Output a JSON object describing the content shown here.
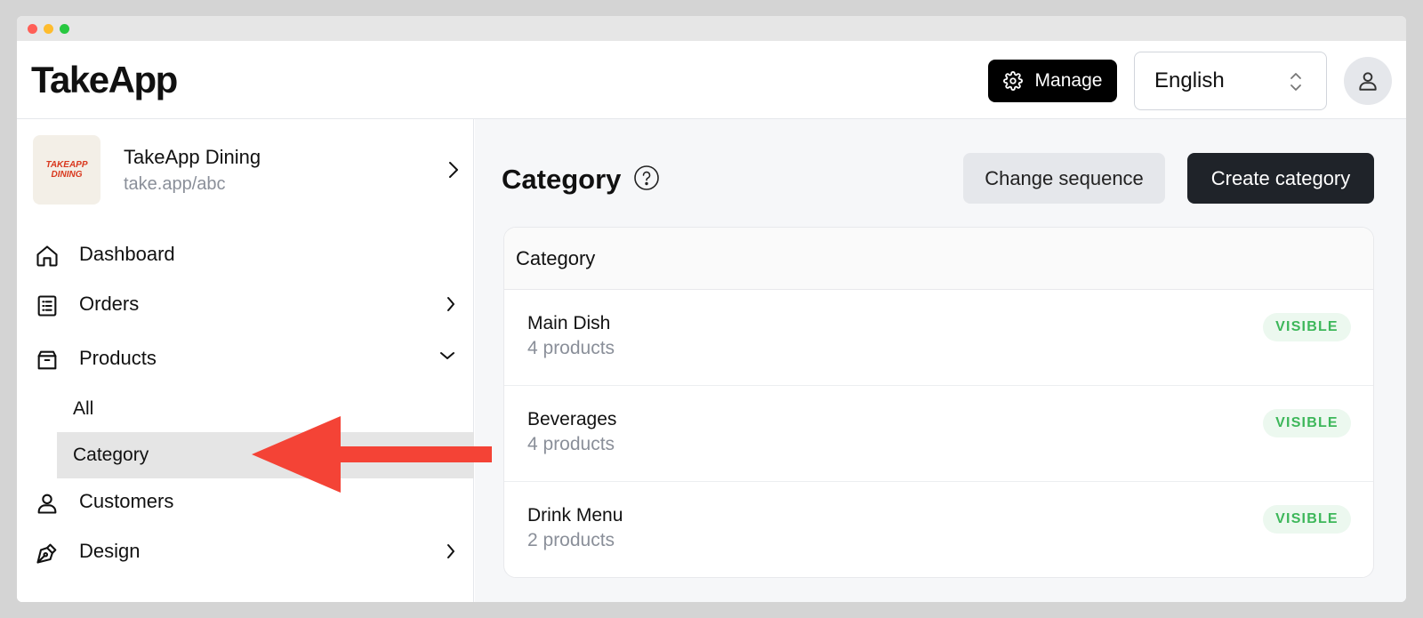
{
  "app": {
    "logo": "TakeApp"
  },
  "header": {
    "manage_label": "Manage",
    "language": "English"
  },
  "sidebar": {
    "store": {
      "name": "TakeApp Dining",
      "url": "take.app/abc",
      "logo_text_1": "TAKEAPP",
      "logo_text_2": "DINING"
    },
    "items": [
      {
        "label": "Dashboard",
        "icon": "home-icon"
      },
      {
        "label": "Orders",
        "icon": "orders-icon"
      },
      {
        "label": "Products",
        "icon": "box-icon"
      },
      {
        "label": "Customers",
        "icon": "user-icon"
      },
      {
        "label": "Design",
        "icon": "pen-icon"
      }
    ],
    "products_sub": [
      {
        "label": "All"
      },
      {
        "label": "Category",
        "active": true
      }
    ]
  },
  "main": {
    "title": "Category",
    "change_sequence_label": "Change sequence",
    "create_category_label": "Create category",
    "table_header": "Category",
    "rows": [
      {
        "name": "Main Dish",
        "count": "4 products",
        "status": "VISIBLE"
      },
      {
        "name": "Beverages",
        "count": "4 products",
        "status": "VISIBLE"
      },
      {
        "name": "Drink Menu",
        "count": "2 products",
        "status": "VISIBLE"
      }
    ]
  },
  "colors": {
    "primary_button": "#1f2329",
    "badge_text": "#3db75a",
    "badge_bg": "#ecf8ef",
    "annotation_arrow": "#f44336"
  }
}
